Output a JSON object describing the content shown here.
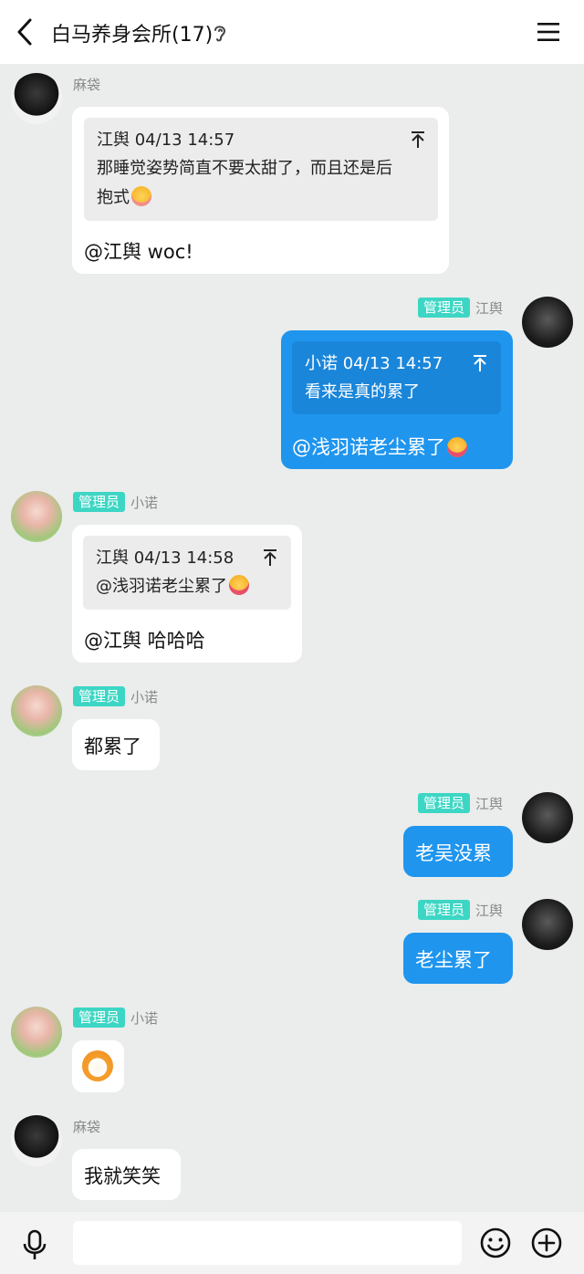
{
  "header": {
    "title": "白马养身会所(17)"
  },
  "messages": [
    {
      "sender": "麻袋",
      "quote_head": "江舆 04/13 14:57",
      "quote_line1": "那睡觉姿势简直不要太甜了，而且还是后",
      "quote_line2": "抱式",
      "text": "@江舆 woc!"
    },
    {
      "badge": "管理员",
      "sender": "江舆",
      "quote_head": "小诺 04/13 14:57",
      "quote_line1": "看来是真的累了",
      "text": "@浅羽诺老尘累了"
    },
    {
      "badge": "管理员",
      "sender": "小诺",
      "quote_head": "江舆 04/13 14:58",
      "quote_line1": "@浅羽诺老尘累了",
      "text": "@江舆 哈哈哈"
    },
    {
      "badge": "管理员",
      "sender": "小诺",
      "text": "都累了"
    },
    {
      "badge": "管理员",
      "sender": "江舆",
      "text": "老吴没累"
    },
    {
      "badge": "管理员",
      "sender": "江舆",
      "text": "老尘累了"
    },
    {
      "badge": "管理员",
      "sender": "小诺"
    },
    {
      "sender": "麻袋",
      "text": "我就笑笑"
    }
  ],
  "input": {
    "placeholder": ""
  },
  "colors": {
    "background": "#eaedeb",
    "self_bubble": "#1f95ee",
    "badge": "#3dd6c4"
  },
  "icons": [
    "back-arrow-icon",
    "ear-icon",
    "menu-icon",
    "pin-top-icon",
    "mic-icon",
    "emoji-icon",
    "plus-icon"
  ]
}
